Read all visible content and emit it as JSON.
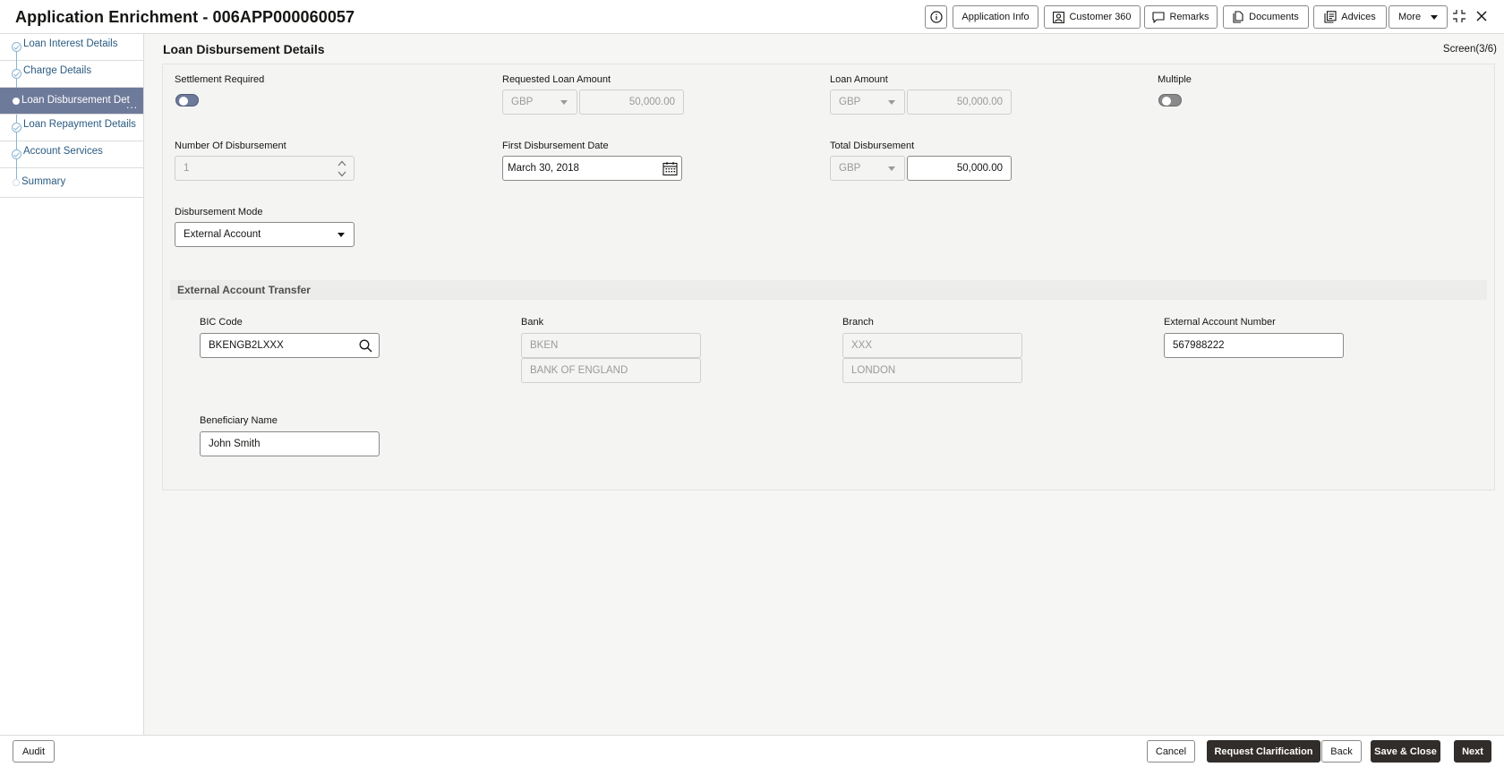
{
  "header": {
    "title": "Application Enrichment - 006APP000060057",
    "buttons": {
      "application_info": "Application Info",
      "customer_360": "Customer 360",
      "remarks": "Remarks",
      "documents": "Documents",
      "advices": "Advices",
      "more": "More"
    }
  },
  "sidebar": {
    "items": [
      {
        "label": "Loan Interest Details"
      },
      {
        "label": "Charge Details"
      },
      {
        "label": "Loan Disbursement Det"
      },
      {
        "label": "Loan Repayment Details"
      },
      {
        "label": "Account Services"
      },
      {
        "label": "Summary"
      }
    ],
    "active_more": "..."
  },
  "main": {
    "section_title": "Loan Disbursement Details",
    "screen_indicator": "Screen(3/6)",
    "fields": {
      "settlement_required": {
        "label": "Settlement Required",
        "value": true
      },
      "requested_loan_amount": {
        "label": "Requested Loan Amount",
        "currency": "GBP",
        "amount": "50,000.00"
      },
      "loan_amount": {
        "label": "Loan Amount",
        "currency": "GBP",
        "amount": "50,000.00"
      },
      "multiple": {
        "label": "Multiple",
        "value": false
      },
      "number_of_disbursement": {
        "label": "Number Of Disbursement",
        "value": "1"
      },
      "first_disbursement_date": {
        "label": "First Disbursement Date",
        "value": "March 30, 2018"
      },
      "total_disbursement": {
        "label": "Total Disbursement",
        "currency": "GBP",
        "amount": "50,000.00"
      },
      "disbursement_mode": {
        "label": "Disbursement Mode",
        "value": "External Account"
      }
    },
    "external_transfer": {
      "title": "External Account Transfer",
      "bic_code": {
        "label": "BIC Code",
        "value": "BKENGB2LXXX"
      },
      "bank": {
        "label": "Bank",
        "code": "BKEN",
        "name": "BANK OF ENGLAND"
      },
      "branch": {
        "label": "Branch",
        "code": "XXX",
        "name": "LONDON"
      },
      "external_account_number": {
        "label": "External Account Number",
        "value": "567988222"
      },
      "beneficiary_name": {
        "label": "Beneficiary Name",
        "value": "John Smith"
      }
    }
  },
  "footer": {
    "audit": "Audit",
    "cancel": "Cancel",
    "request_clarification": "Request Clarification",
    "back": "Back",
    "save_close": "Save & Close",
    "next": "Next"
  },
  "colors": {
    "accent": "#6e7a9a",
    "dark_button": "#312d2a",
    "link": "#2a5b80"
  }
}
